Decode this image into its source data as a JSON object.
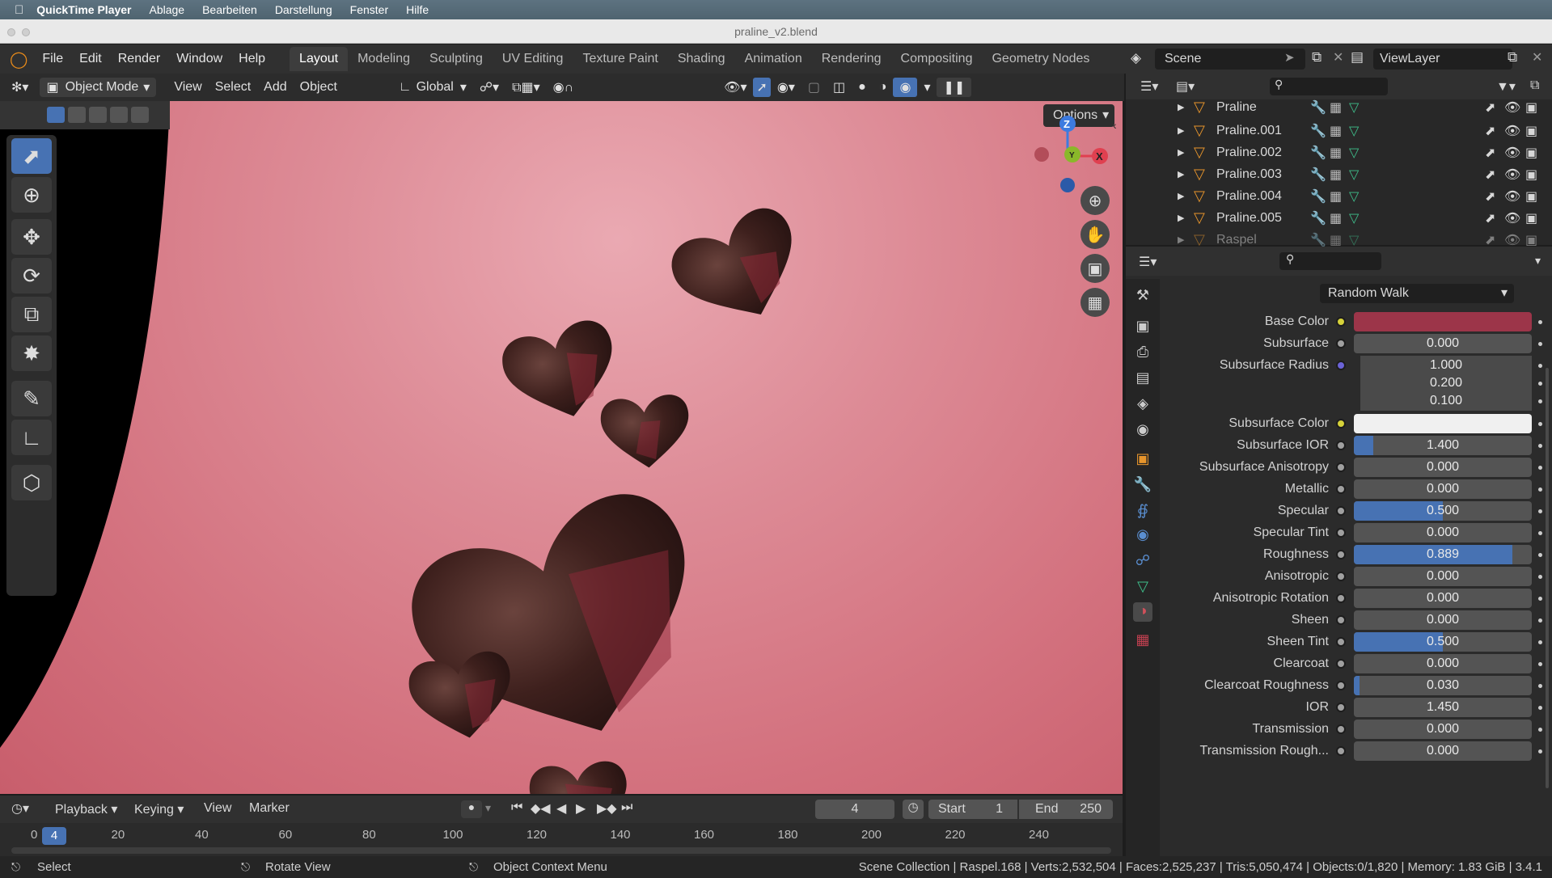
{
  "mac_menu": {
    "app": "QuickTime Player",
    "items": [
      "Ablage",
      "Bearbeiten",
      "Darstellung",
      "Fenster",
      "Hilfe"
    ]
  },
  "window_title": "praline_v2.blend",
  "top_menu": [
    "File",
    "Edit",
    "Render",
    "Window",
    "Help"
  ],
  "workspaces": [
    "Layout",
    "Modeling",
    "Sculpting",
    "UV Editing",
    "Texture Paint",
    "Shading",
    "Animation",
    "Rendering",
    "Compositing",
    "Geometry Nodes"
  ],
  "active_workspace": "Layout",
  "scene_name": "Scene",
  "view_layer": "ViewLayer",
  "viewport_header": {
    "mode": "Object Mode",
    "menus": [
      "View",
      "Select",
      "Add",
      "Object"
    ],
    "transform": "Global",
    "options": "Options"
  },
  "gizmo": {
    "z": "Z",
    "x": "X",
    "y": "Y"
  },
  "outliner": {
    "items": [
      "Praline",
      "Praline.001",
      "Praline.002",
      "Praline.003",
      "Praline.004",
      "Praline.005",
      "Raspel"
    ]
  },
  "properties": {
    "subsurface_method": "Random Walk",
    "rows": [
      {
        "label": "Base Color",
        "type": "color",
        "color": "#9c3549",
        "socket": "#d6d23a"
      },
      {
        "label": "Subsurface",
        "value": "0.000",
        "fill": 0
      },
      {
        "label": "Subsurface Radius",
        "value": "1.000",
        "fill": 0,
        "socket": "#6b63d6"
      },
      {
        "label": "",
        "value": "0.200",
        "fill": 0,
        "nosock": true
      },
      {
        "label": "",
        "value": "0.100",
        "fill": 0,
        "nosock": true
      },
      {
        "label": "Subsurface Color",
        "type": "color",
        "color": "#f0f0f0",
        "socket": "#d6d23a"
      },
      {
        "label": "Subsurface IOR",
        "value": "1.400",
        "fill": 0.11
      },
      {
        "label": "Subsurface Anisotropy",
        "value": "0.000",
        "fill": 0
      },
      {
        "label": "Metallic",
        "value": "0.000",
        "fill": 0
      },
      {
        "label": "Specular",
        "value": "0.500",
        "fill": 0.5
      },
      {
        "label": "Specular Tint",
        "value": "0.000",
        "fill": 0
      },
      {
        "label": "Roughness",
        "value": "0.889",
        "fill": 0.889
      },
      {
        "label": "Anisotropic",
        "value": "0.000",
        "fill": 0
      },
      {
        "label": "Anisotropic Rotation",
        "value": "0.000",
        "fill": 0
      },
      {
        "label": "Sheen",
        "value": "0.000",
        "fill": 0
      },
      {
        "label": "Sheen Tint",
        "value": "0.500",
        "fill": 0.5
      },
      {
        "label": "Clearcoat",
        "value": "0.000",
        "fill": 0
      },
      {
        "label": "Clearcoat Roughness",
        "value": "0.030",
        "fill": 0.03
      },
      {
        "label": "IOR",
        "value": "1.450",
        "fill": 0
      },
      {
        "label": "Transmission",
        "value": "0.000",
        "fill": 0
      },
      {
        "label": "Transmission Rough...",
        "value": "0.000",
        "fill": 0
      }
    ]
  },
  "timeline": {
    "menus": [
      "Playback",
      "Keying",
      "View",
      "Marker"
    ],
    "current_frame": "4",
    "start_label": "Start",
    "start": "1",
    "end_label": "End",
    "end": "250",
    "ticks": [
      "0",
      "20",
      "40",
      "60",
      "80",
      "100",
      "120",
      "140",
      "160",
      "180",
      "200",
      "220",
      "240"
    ]
  },
  "status": {
    "select": "Select",
    "rotate": "Rotate View",
    "context": "Object Context Menu",
    "stats": "Scene Collection | Raspel.168 | Verts:2,532,504 | Faces:2,525,237 | Tris:5,050,474 | Objects:0/1,820 | Memory: 1.83 GiB | 3.4.1"
  }
}
